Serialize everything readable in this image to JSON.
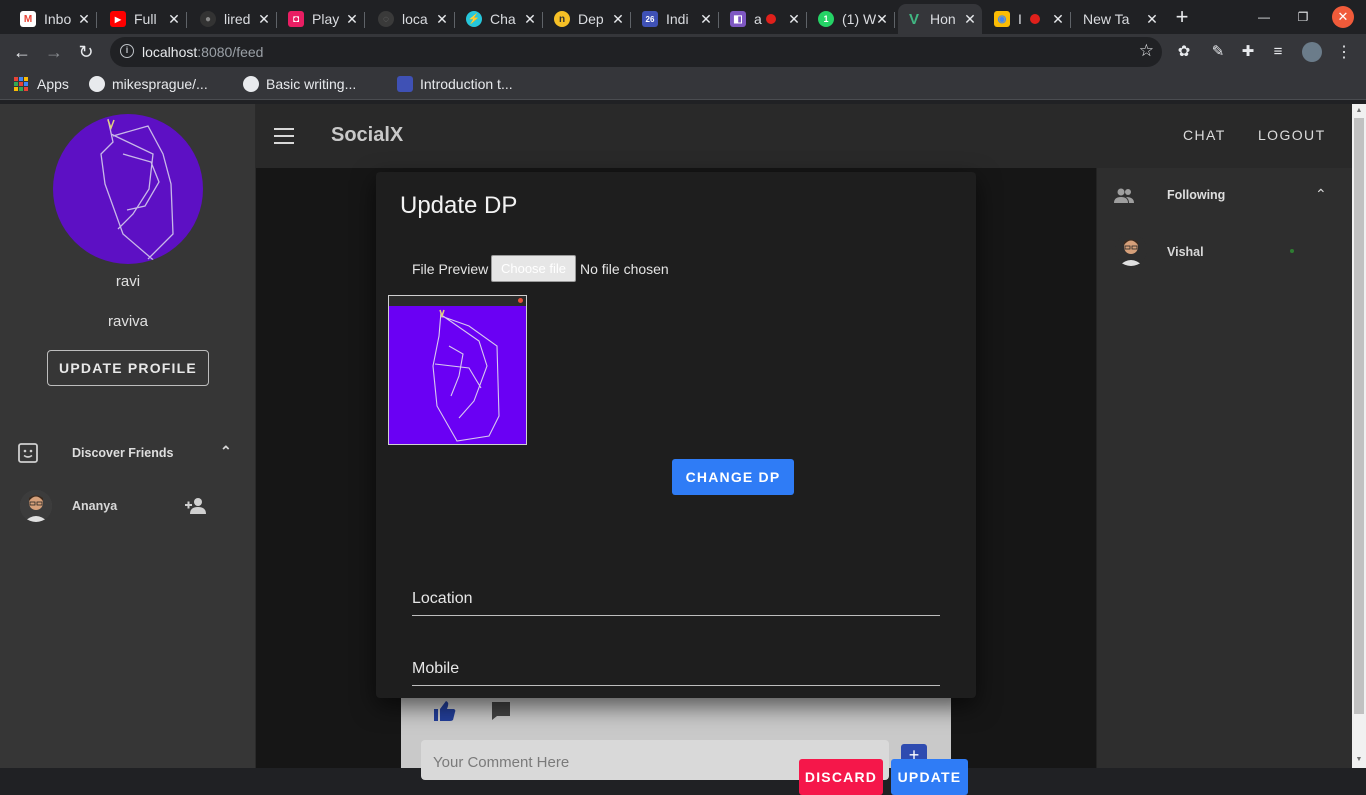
{
  "browser": {
    "tabs": [
      {
        "label": "Inbo",
        "color": "#ffffff",
        "fg": "#ea4335",
        "glyph": "M"
      },
      {
        "label": "Full",
        "color": "#ff0000",
        "fg": "#ffffff",
        "glyph": "▶"
      },
      {
        "label": "lired",
        "color": "#333333",
        "fg": "#888888",
        "glyph": "●"
      },
      {
        "label": "Play",
        "color": "#e91e63",
        "fg": "#ffffff",
        "glyph": "◘"
      },
      {
        "label": "loca",
        "color": "#3a3a3a",
        "fg": "#777777",
        "glyph": "◌"
      },
      {
        "label": "Cha",
        "color": "#26c6da",
        "fg": "#ffffff",
        "glyph": "⚡"
      },
      {
        "label": "Dep",
        "color": "#f6c026",
        "fg": "#333333",
        "glyph": "n"
      },
      {
        "label": "Indi",
        "color": "#3f51b5",
        "fg": "#ffffff",
        "glyph": "26"
      },
      {
        "label": "a",
        "color": "#7e57c2",
        "fg": "#ffffff",
        "glyph": "◧"
      },
      {
        "label": "(1) W",
        "color": "#25d366",
        "fg": "#ffffff",
        "glyph": "1"
      },
      {
        "label": "Hon",
        "color": "#41b883",
        "fg": "#35495e",
        "glyph": "V"
      },
      {
        "label": "I",
        "color": "#fbbc05",
        "fg": "#4285f4",
        "glyph": "◉"
      },
      {
        "label": "New Ta",
        "color": "",
        "fg": "",
        "glyph": ""
      }
    ],
    "url_host": "localhost",
    "url_path": ":8080/feed",
    "bookmarks": [
      {
        "label": "Apps"
      },
      {
        "label": "mikesprague/..."
      },
      {
        "label": "Basic writing..."
      },
      {
        "label": "Introduction t..."
      }
    ]
  },
  "app": {
    "brand": "SocialX",
    "nav": {
      "chat": "CHAT",
      "logout": "LOGOUT"
    },
    "user": {
      "name": "ravi",
      "username": "raviva",
      "update_profile": "UPDATE PROFILE"
    },
    "discover": {
      "title": "Discover Friends",
      "people": [
        {
          "name": "Ananya"
        }
      ]
    },
    "following": {
      "title": "Following",
      "people": [
        {
          "name": "Vishal",
          "online_color": "#2e7d32"
        }
      ]
    },
    "comment_placeholder": "Your Comment Here"
  },
  "dialog": {
    "title": "Update DP",
    "file_preview_label": "File Preview",
    "choose_file": "Choose file",
    "no_file": "No file chosen",
    "change_dp": "CHANGE DP",
    "location_label": "Location",
    "mobile_label": "Mobile",
    "discard": "DISCARD",
    "update": "UPDATE"
  },
  "colors": {
    "primary": "#2f7cf6",
    "danger": "#f5174a",
    "avatar_purple": "#5d10c4"
  }
}
